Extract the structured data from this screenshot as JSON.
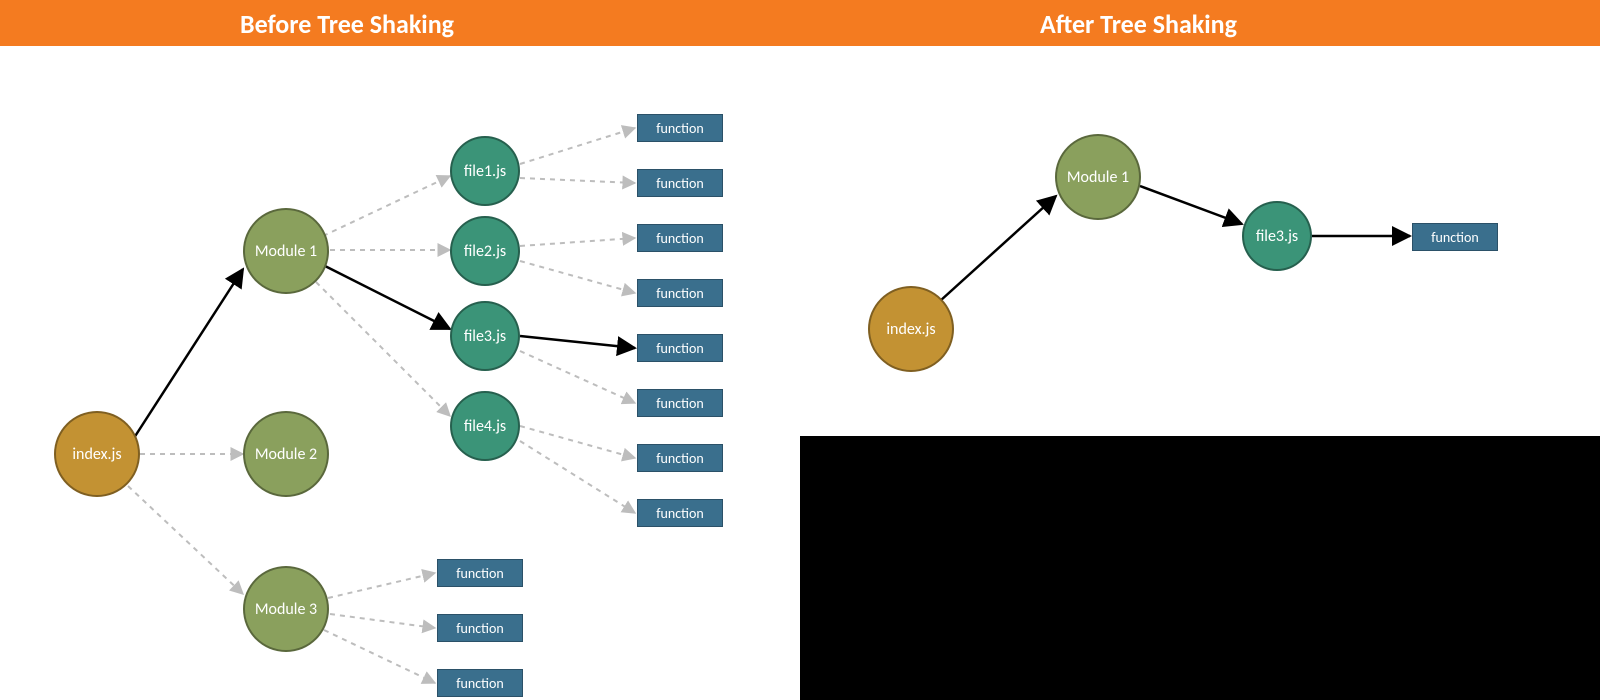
{
  "header": {
    "before_title": "Before Tree Shaking",
    "after_title": "After Tree Shaking"
  },
  "colors": {
    "header_bg": "#f47b20",
    "root_node": "#c39233",
    "module_node": "#8aa05d",
    "file_node": "#3b9478",
    "function_box": "#3a6f8d"
  },
  "before": {
    "root": "index.js",
    "modules": [
      "Module 1",
      "Module 2",
      "Module 3"
    ],
    "files": [
      "file1.js",
      "file2.js",
      "file3.js",
      "file4.js"
    ],
    "function_label": "function",
    "function_count_main": 8,
    "function_count_mod3": 3,
    "active_path": [
      "index.js",
      "Module 1",
      "file3.js",
      "function"
    ]
  },
  "after": {
    "root": "index.js",
    "module": "Module 1",
    "file": "file3.js",
    "function_label": "function"
  }
}
